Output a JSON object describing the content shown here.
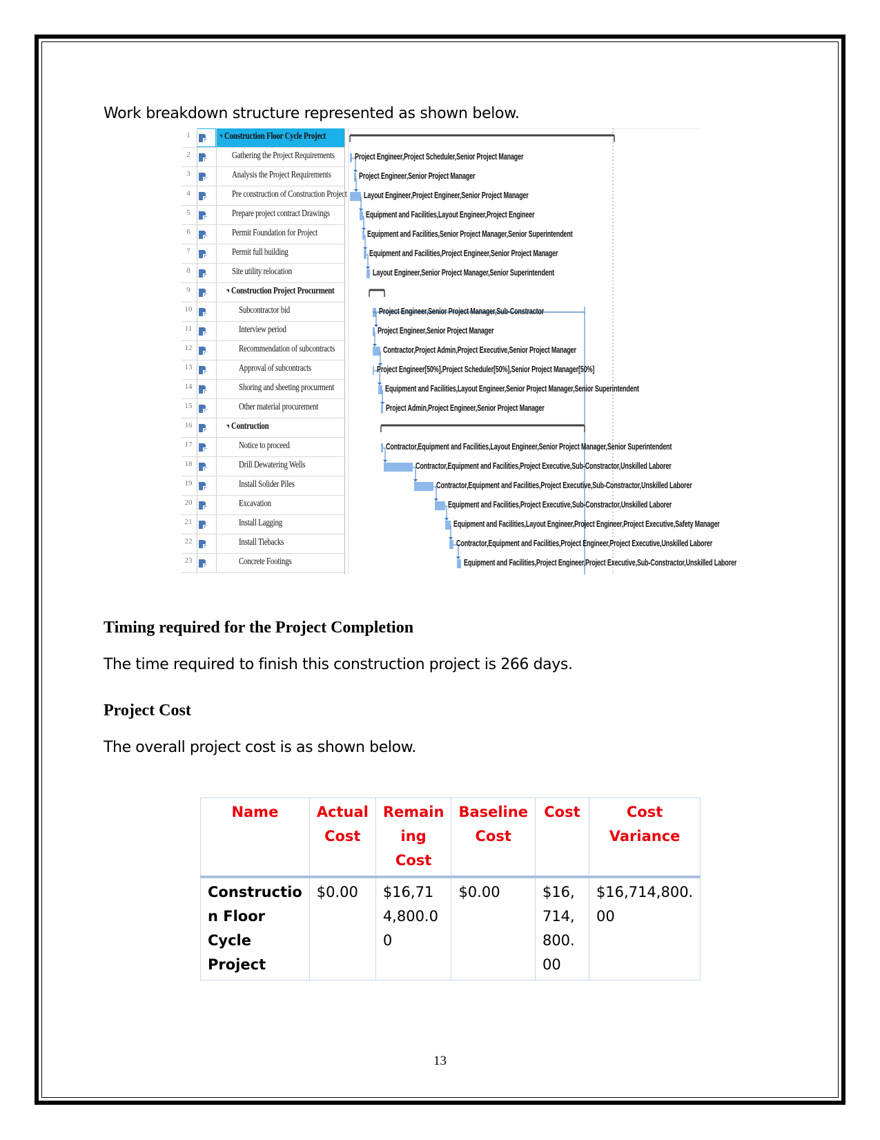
{
  "intro_text": "Work breakdown structure represented as shown below.",
  "gantt": {
    "tasks": [
      {
        "id": "1",
        "name": "Construction Floor Cycle Project",
        "level": 0,
        "summary": true,
        "selected": true,
        "resources": ""
      },
      {
        "id": "2",
        "name": "Gathering the Project Requirements",
        "level": 1,
        "summary": false,
        "resources": "Project Engineer,Project Scheduler,Senior Project Manager"
      },
      {
        "id": "3",
        "name": "Analysis the Project Requirements",
        "level": 1,
        "summary": false,
        "resources": "Project Engineer,Senior Project Manager"
      },
      {
        "id": "4",
        "name": "Pre construction of Construction Project",
        "level": 1,
        "summary": false,
        "resources": "Layout Engineer,Project Engineer,Senior Project Manager"
      },
      {
        "id": "5",
        "name": "Prepare project contract Drawings",
        "level": 1,
        "summary": false,
        "resources": "Equipment and Facilities,Layout Engineer,Project Engineer"
      },
      {
        "id": "6",
        "name": "Permit Foundation for Project",
        "level": 1,
        "summary": false,
        "resources": "Equipment and Facilities,Senior Project Manager,Senior Superintendent"
      },
      {
        "id": "7",
        "name": "Permit full building",
        "level": 1,
        "summary": false,
        "resources": "Equipment and Facilities,Project Engineer,Senior Project Manager"
      },
      {
        "id": "8",
        "name": "Site utility relocation",
        "level": 1,
        "summary": false,
        "resources": "Layout Engineer,Senior Project Manager,Senior Superintendent"
      },
      {
        "id": "9",
        "name": "Construction Project Procurment",
        "level": 1,
        "summary": true,
        "resources": ""
      },
      {
        "id": "10",
        "name": "Subcontractor bid",
        "level": 2,
        "summary": false,
        "resources": "Project Engineer,Senior Project Manager,Sub-Constractor"
      },
      {
        "id": "11",
        "name": "Interview period",
        "level": 2,
        "summary": false,
        "resources": "Project Engineer,Senior Project Manager"
      },
      {
        "id": "12",
        "name": "Recommendation of subcontracts",
        "level": 2,
        "summary": false,
        "resources": "Contractor,Project Admin,Project Executive,Senior Project Manager"
      },
      {
        "id": "13",
        "name": "Approval of subcontracts",
        "level": 2,
        "summary": false,
        "resources": "Project Engineer[50%],Project Scheduler[50%],Senior Project Manager[50%]"
      },
      {
        "id": "14",
        "name": "Shoring and sheeting procurment",
        "level": 2,
        "summary": false,
        "resources": "Equipment and Facilities,Layout Engineer,Senior Project Manager,Senior Superintendent"
      },
      {
        "id": "15",
        "name": "Other material procurement",
        "level": 2,
        "summary": false,
        "resources": "Project Admin,Project Engineer,Senior Project Manager"
      },
      {
        "id": "16",
        "name": "Contruction",
        "level": 1,
        "summary": true,
        "resources": ""
      },
      {
        "id": "17",
        "name": "Notice to proceed",
        "level": 2,
        "summary": false,
        "resources": "Contractor,Equipment and Facilities,Layout Engineer,Senior Project Manager,Senior Superintendent"
      },
      {
        "id": "18",
        "name": "Drill Dewatering Wells",
        "level": 2,
        "summary": false,
        "resources": "Contractor,Equipment and Facilities,Project Executive,Sub-Constractor,Unskilled Laborer"
      },
      {
        "id": "19",
        "name": "Install Solider Piles",
        "level": 2,
        "summary": false,
        "resources": "Contractor,Equipment and Facilities,Project Executive,Sub-Constractor,Unskilled Laborer"
      },
      {
        "id": "20",
        "name": "Excavation",
        "level": 2,
        "summary": false,
        "resources": "Equipment and Facilities,Project Executive,Sub-Constractor,Unskilled Laborer"
      },
      {
        "id": "21",
        "name": "Install Lagging",
        "level": 2,
        "summary": false,
        "resources": "Equipment and Facilities,Layout Engineer,Project Engineer,Project Executive,Safety Manager"
      },
      {
        "id": "22",
        "name": "Install Tiebacks",
        "level": 2,
        "summary": false,
        "resources": "Contractor,Equipment and Facilities,Project Engineer,Project Executive,Unskilled Laborer"
      },
      {
        "id": "23",
        "name": "Concrete Footings",
        "level": 2,
        "summary": false,
        "resources": "Equipment and Facilities,Project Engineer,Project Executive,Sub-Constractor,Unskilled Laborer"
      }
    ],
    "icons": {
      "task_mode": "auto-scheduled-task-icon",
      "collapse": "collapse-triangle-icon"
    },
    "colors": {
      "selected_row": "#1cb0e8",
      "bar": "#8fb8ea",
      "link": "#3b78c3",
      "summary": "#444444"
    }
  },
  "timing_heading": "Timing required for the Project Completion",
  "timing_text": "The time required to finish this construction project is 266 days.",
  "cost_heading": "Project Cost",
  "cost_text": "The overall project cost is as shown below.",
  "cost_table": {
    "headers": [
      [
        "Name"
      ],
      [
        "Actual",
        "Cost"
      ],
      [
        "Remain",
        "ing",
        "Cost"
      ],
      [
        "Baseline",
        "Cost"
      ],
      [
        "Cost"
      ],
      [
        "Cost",
        "Variance"
      ]
    ],
    "row": [
      [
        "Constructio",
        "n Floor",
        "Cycle",
        "Project"
      ],
      [
        "$0.00"
      ],
      [
        "$16,71",
        "4,800.0",
        "0"
      ],
      [
        "$0.00"
      ],
      [
        "$16,",
        "714,",
        "800.",
        "00"
      ],
      [
        "$16,714,800.",
        "00"
      ]
    ],
    "header_color": "#e8000b"
  },
  "page_number": "13"
}
